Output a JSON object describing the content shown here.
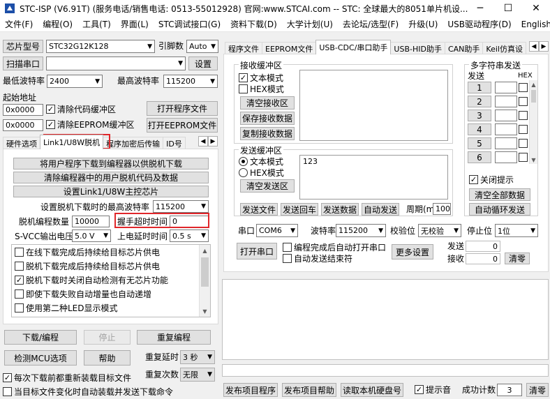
{
  "window": {
    "title": "STC-ISP (V6.91T) (服务电话/销售电话: 0513-55012928) 官网:www.STCAI.com  -- STC: 全球最大的8051单片机设...",
    "minimize_icon": "─",
    "maximize_icon": "☐",
    "close_icon": "✕"
  },
  "menu": [
    "文件(F)",
    "编程(O)",
    "工具(T)",
    "界面(L)",
    "STC调试接口(G)",
    "资料下载(D)",
    "大学计划(U)",
    "去论坛/选型(F)",
    "升级(U)",
    "USB驱动程序(D)",
    "English"
  ],
  "left": {
    "chip_btn": "芯片型号",
    "chip_value": "STC32G12K128",
    "pin_label": "引脚数",
    "pin_value": "Auto",
    "scan_btn": "扫描串口",
    "port_value": "",
    "settings_btn": "设置",
    "min_baud_label": "最低波特率",
    "min_baud_value": "2400",
    "max_baud_label": "最高波特率",
    "max_baud_value": "115200",
    "start_addr_label": "起始地址",
    "addr1_value": "0x0000",
    "clear_code_label": "清除代码缓冲区",
    "open_prog_btn": "打开程序文件",
    "addr2_value": "0x0000",
    "clear_eeprom_label": "清除EEPROM缓冲区",
    "open_eeprom_btn": "打开EEPROM文件",
    "tabs": [
      "硬件选项",
      "Link1/U8W脱机",
      "程序加密后传输",
      "ID号"
    ],
    "offline": {
      "btn1": "将用户程序下载到编程器以供脱机下载",
      "btn2": "清除编程器中的用户脱机代码及数据",
      "btn3": "设置Link1/U8W主控芯片",
      "max_baud_label": "设置脱机下载时的最高波特率",
      "max_baud_value": "115200",
      "count_label": "脱机编程数量",
      "count_value": "10000",
      "handshake_label": "握手超时时间",
      "handshake_value": "0",
      "svcc_label": "S-VCC输出电压",
      "svcc_value": "5.0 V",
      "delay_label": "上电延时时间",
      "delay_value": "0.5 s",
      "options": [
        {
          "label": "在线下载完成后持续给目标芯片供电",
          "checked": false
        },
        {
          "label": "脱机下载完成后持续给目标芯片供电",
          "checked": false
        },
        {
          "label": "脱机下载时关闭自动检测有无芯片功能",
          "checked": true
        },
        {
          "label": "即使下载失败自动增量也自动递增",
          "checked": false
        },
        {
          "label": "使用第二种LED显示模式",
          "checked": false
        }
      ]
    },
    "download_btn": "下载/编程",
    "stop_btn": "停止",
    "redownload_btn": "重复编程",
    "detect_btn": "检测MCU选项",
    "help_btn": "帮助",
    "repeat_delay_label": "重复延时",
    "repeat_delay_value": "3 秒",
    "repeat_count_label": "重复次数",
    "repeat_count_value": "无限",
    "reload_label": "每次下载前都重新装载目标文件",
    "reload_checked": true,
    "autoload_label": "当目标文件变化时自动装载并发送下载命令",
    "autoload_checked": false
  },
  "right": {
    "tabs": [
      "程序文件",
      "EEPROM文件",
      "USB-CDC/串口助手",
      "USB-HID助手",
      "CAN助手",
      "Keil仿真设"
    ],
    "rx": {
      "title": "接收缓冲区",
      "text_mode": "文本模式",
      "hex_mode": "HEX模式",
      "clear_btn": "清空接收区",
      "save_btn": "保存接收数据",
      "copy_btn": "复制接收数据",
      "text_checked": true,
      "hex_checked": false
    },
    "tx": {
      "title": "发送缓冲区",
      "text_mode": "文本模式",
      "hex_mode": "HEX模式",
      "clear_btn": "清空发送区",
      "content": "123",
      "send_file_btn": "发送文件",
      "send_return_btn": "发送回车",
      "send_data_btn": "发送数据",
      "auto_send_btn": "自动发送",
      "period_label": "周期(ms)",
      "period_value": "100"
    },
    "multi": {
      "title": "多字符串发送",
      "send_col": "发送",
      "hex_col": "HEX",
      "rows": [
        "1",
        "2",
        "3",
        "4",
        "5",
        "6"
      ],
      "close_hint_label": "关闭提示",
      "close_hint_checked": true,
      "clear_all_btn": "清空全部数据",
      "auto_loop_btn": "自动循环发送"
    },
    "port_label": "串口",
    "port_value": "COM6",
    "baud_label": "波特率",
    "baud_value": "115200",
    "parity_label": "校验位",
    "parity_value": "无校验",
    "stop_label": "停止位",
    "stop_value": "1位",
    "open_port_btn": "打开串口",
    "auto_open_label": "编程完成后自动打开串口",
    "auto_end_label": "自动发送结束符",
    "more_btn": "更多设置",
    "sent_label": "发送",
    "sent_value": "0",
    "recv_label": "接收",
    "recv_value": "0",
    "clear_count_btn": "清零"
  },
  "bottom": {
    "publish_prog_btn": "发布项目程序",
    "publish_help_btn": "发布项目帮助",
    "read_disk_btn": "读取本机硬盘号",
    "beep_label": "提示音",
    "beep_checked": true,
    "success_label": "成功计数",
    "success_value": "3",
    "clear_btn": "清零"
  }
}
